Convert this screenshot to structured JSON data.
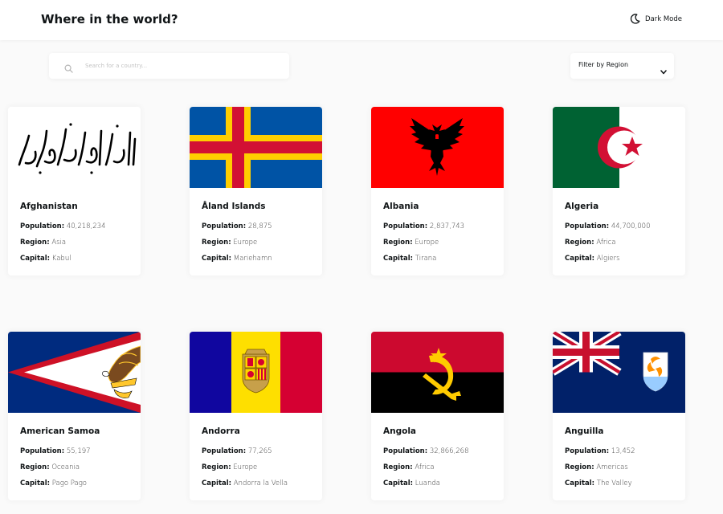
{
  "header": {
    "title": "Where in the world?",
    "theme_toggle_label": "Dark Mode",
    "theme_icon": "moon-icon"
  },
  "search": {
    "placeholder": "Search for a country...",
    "value": "",
    "icon": "search-icon"
  },
  "filter": {
    "label": "Filter by Region",
    "icon": "chevron-down-icon"
  },
  "labels": {
    "population": "Population:",
    "region": "Region:",
    "capital": "Capital:"
  },
  "countries": [
    {
      "name": "Afghanistan",
      "population": "40,218,234",
      "region": "Asia",
      "capital": "Kabul",
      "flag": "afghanistan-flag"
    },
    {
      "name": "Åland Islands",
      "population": "28,875",
      "region": "Europe",
      "capital": "Mariehamn",
      "flag": "aland-islands-flag"
    },
    {
      "name": "Albania",
      "population": "2,837,743",
      "region": "Europe",
      "capital": "Tirana",
      "flag": "albania-flag"
    },
    {
      "name": "Algeria",
      "population": "44,700,000",
      "region": "Africa",
      "capital": "Algiers",
      "flag": "algeria-flag"
    },
    {
      "name": "American Samoa",
      "population": "55,197",
      "region": "Oceania",
      "capital": "Pago Pago",
      "flag": "american-samoa-flag"
    },
    {
      "name": "Andorra",
      "population": "77,265",
      "region": "Europe",
      "capital": "Andorra la Vella",
      "flag": "andorra-flag"
    },
    {
      "name": "Angola",
      "population": "32,866,268",
      "region": "Africa",
      "capital": "Luanda",
      "flag": "angola-flag"
    },
    {
      "name": "Anguilla",
      "population": "13,452",
      "region": "Americas",
      "capital": "The Valley",
      "flag": "anguilla-flag"
    }
  ],
  "colors": {
    "background": "#fafafa",
    "card": "#ffffff",
    "text": "#111517",
    "placeholder": "#c4c4c4"
  }
}
